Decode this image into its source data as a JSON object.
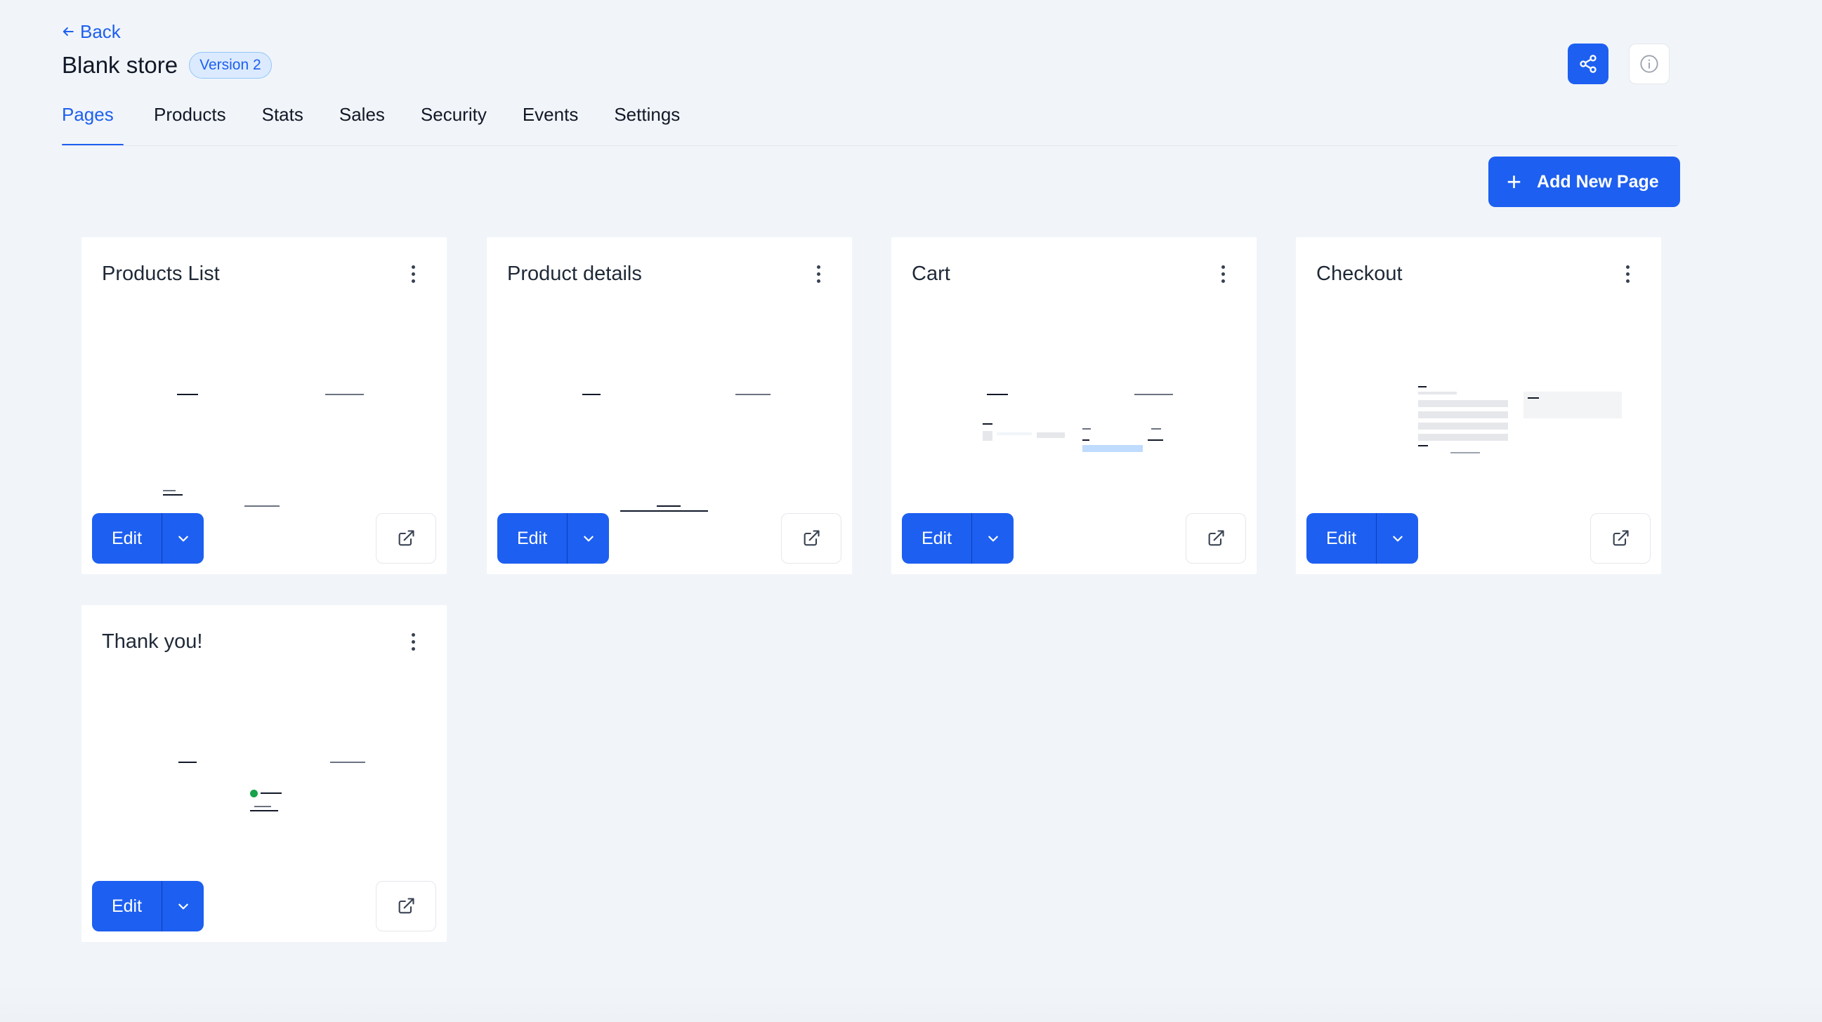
{
  "header": {
    "back_label": "Back",
    "store_title": "Blank store",
    "version_badge": "Version 2"
  },
  "tabs": [
    {
      "label": "Pages",
      "active": true
    },
    {
      "label": "Products"
    },
    {
      "label": "Stats"
    },
    {
      "label": "Sales"
    },
    {
      "label": "Security"
    },
    {
      "label": "Events"
    },
    {
      "label": "Settings"
    }
  ],
  "actions": {
    "add_page_label": "Add New Page"
  },
  "pages": [
    {
      "title": "Products List",
      "edit_label": "Edit"
    },
    {
      "title": "Product details",
      "edit_label": "Edit"
    },
    {
      "title": "Cart",
      "edit_label": "Edit"
    },
    {
      "title": "Checkout",
      "edit_label": "Edit"
    },
    {
      "title": "Thank you!",
      "edit_label": "Edit"
    }
  ],
  "colors": {
    "accent": "#1d5ff0",
    "background": "#f1f5f9",
    "card": "#ffffff",
    "badge_bg": "#dbeafe"
  },
  "icons": {
    "back": "arrow-left-icon",
    "share": "share-icon",
    "info": "info-icon",
    "add": "plus-icon",
    "menu": "kebab-menu-icon",
    "dropdown": "chevron-down-icon",
    "open": "external-link-icon"
  }
}
